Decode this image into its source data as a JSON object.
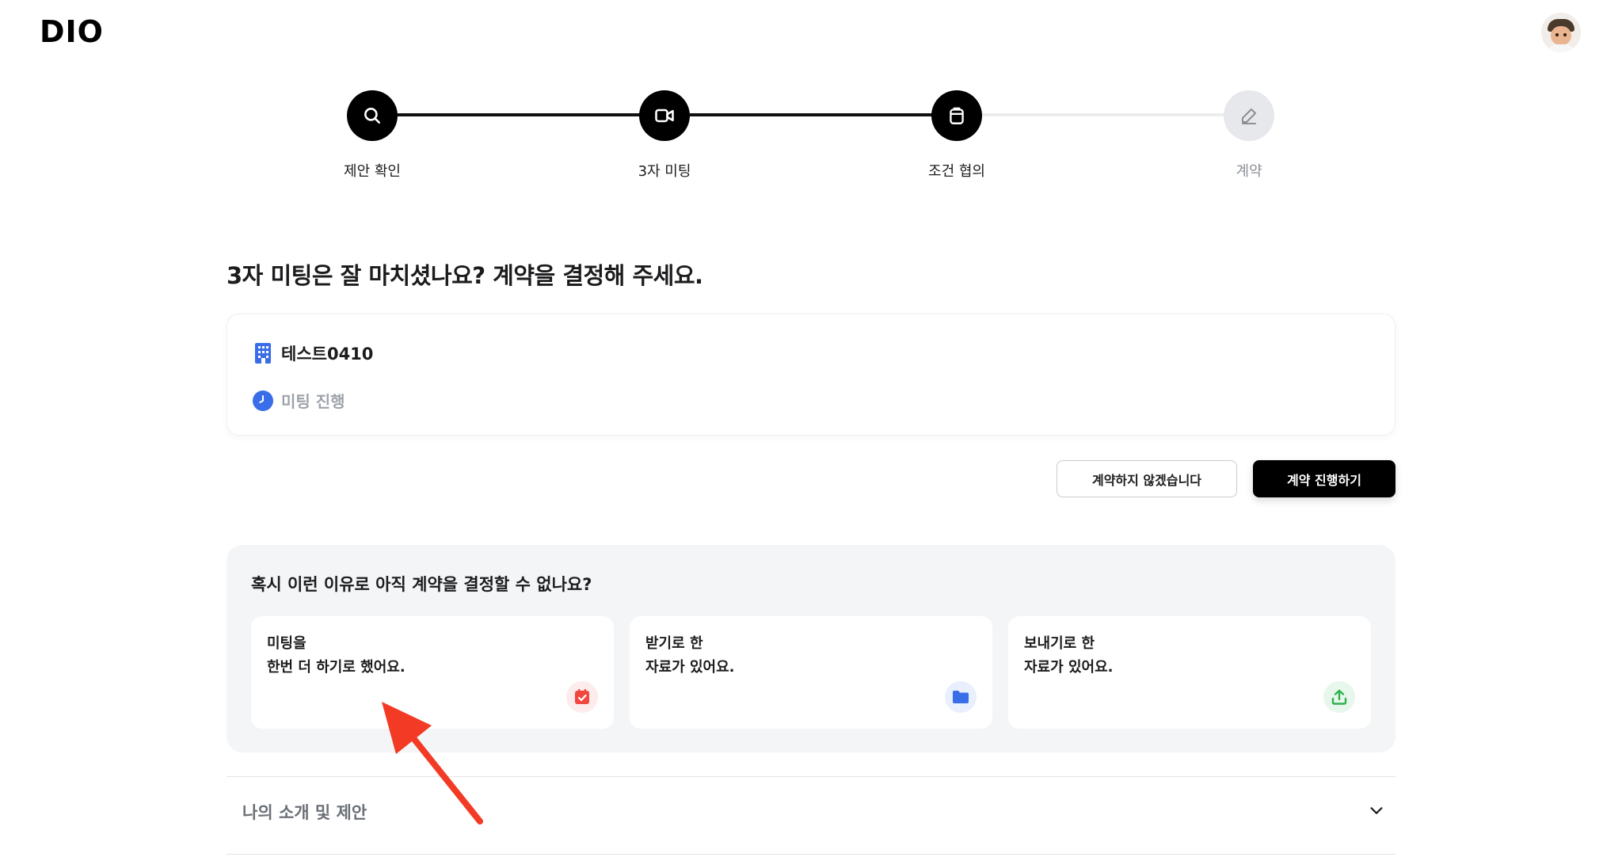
{
  "header": {
    "logo": "DIO",
    "avatar": "user-avatar"
  },
  "stepper": {
    "steps": [
      {
        "label": "제안 확인",
        "icon": "search-icon",
        "state": "done"
      },
      {
        "label": "3자 미팅",
        "icon": "video-icon",
        "state": "done"
      },
      {
        "label": "조건 협의",
        "icon": "clipboard-icon",
        "state": "current"
      },
      {
        "label": "계약",
        "icon": "pencil-icon",
        "state": "todo"
      }
    ]
  },
  "main": {
    "title": "3자 미팅은 잘 마치셨나요? 계약을 결정해 주세요.",
    "card": {
      "company_icon": "building-icon",
      "company_name": "테스트0410",
      "status_icon": "clock-icon",
      "status": "미팅 진행"
    },
    "actions": {
      "decline_label": "계약하지 않겠습니다",
      "proceed_label": "계약 진행하기"
    }
  },
  "reasons": {
    "title": "혹시 이런 이유로 아직 계약을 결정할 수 없나요?",
    "items": [
      {
        "text": "미팅을\n한번 더 하기로 했어요.",
        "icon": "calendar-check-icon",
        "color": "#f0483e",
        "bg": "#fdecec"
      },
      {
        "text": "받기로 한\n자료가 있어요.",
        "icon": "folder-icon",
        "color": "#3a6ee8",
        "bg": "#e9effc"
      },
      {
        "text": "보내기로 한\n자료가 있어요.",
        "icon": "upload-icon",
        "color": "#2fb24c",
        "bg": "#e8f7ec"
      }
    ]
  },
  "accordion": {
    "title": "나의 소개 및 제안",
    "icon": "chevron-down-icon"
  },
  "colors": {
    "accent": "#000000",
    "blue": "#3a6ee8",
    "muted": "#9ea3aa",
    "panel": "#f3f5f7",
    "annotation": "#f23a24"
  }
}
